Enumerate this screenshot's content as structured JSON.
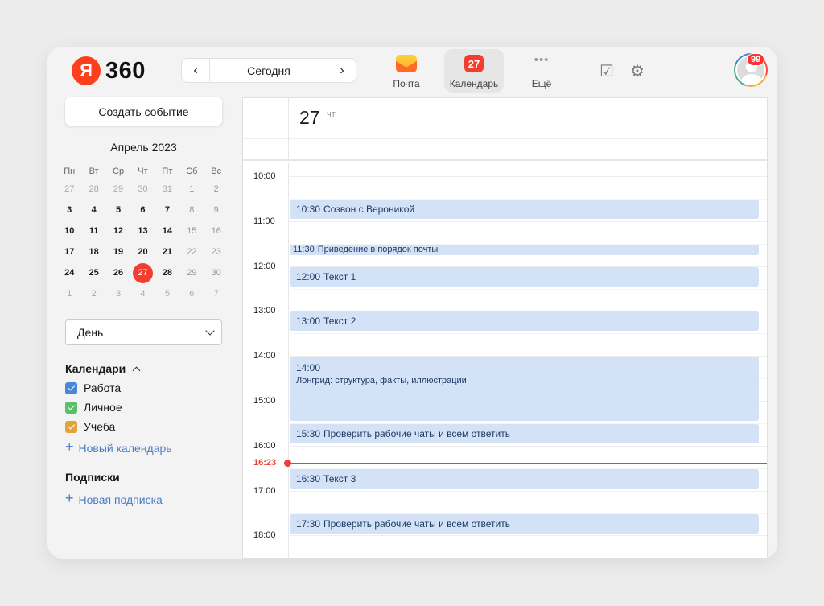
{
  "header": {
    "logo_letter": "Я",
    "logo_text": "360",
    "nav": {
      "today": "Сегодня",
      "prev": "‹",
      "next": "›"
    },
    "services": [
      {
        "label": "Почта",
        "icon": "mail-icon"
      },
      {
        "label": "Календарь",
        "icon": "calendar-icon",
        "badge": "27",
        "active": true
      },
      {
        "label": "Ещё",
        "icon": "more-icon"
      }
    ],
    "avatar_badge": "99"
  },
  "sidebar": {
    "create_label": "Создать событие",
    "month_title": "Апрель 2023",
    "weekdays": [
      "Пн",
      "Вт",
      "Ср",
      "Чт",
      "Пт",
      "Сб",
      "Вс"
    ],
    "weeks": [
      [
        "27",
        "28",
        "29",
        "30",
        "31",
        "1",
        "2"
      ],
      [
        "3",
        "4",
        "5",
        "6",
        "7",
        "8",
        "9"
      ],
      [
        "10",
        "11",
        "12",
        "13",
        "14",
        "15",
        "16"
      ],
      [
        "17",
        "18",
        "19",
        "20",
        "21",
        "22",
        "23"
      ],
      [
        "24",
        "25",
        "26",
        "27",
        "28",
        "29",
        "30"
      ],
      [
        "1",
        "2",
        "3",
        "4",
        "5",
        "6",
        "7"
      ]
    ],
    "view_select": "День",
    "calendars_title": "Календари",
    "calendars": [
      {
        "label": "Работа",
        "color": "#4a86d9"
      },
      {
        "label": "Личное",
        "color": "#5bbf6a"
      },
      {
        "label": "Учеба",
        "color": "#e2a33b"
      }
    ],
    "new_calendar": "Новый календарь",
    "subscriptions_title": "Подписки",
    "new_subscription": "Новая подписка"
  },
  "day_view": {
    "day_number": "27",
    "weekday": "чт",
    "hours": [
      "10:00",
      "11:00",
      "12:00",
      "13:00",
      "14:00",
      "15:00",
      "16:00",
      "17:00",
      "18:00"
    ],
    "now_label": "16:23",
    "events": [
      {
        "time": "10:30",
        "title": "Созвон с Вероникой"
      },
      {
        "time": "11:30",
        "title": "Приведение в порядок почты"
      },
      {
        "time": "12:00",
        "title": "Текст 1"
      },
      {
        "time": "13:00",
        "title": "Текст 2"
      },
      {
        "time": "14:00",
        "title": "Лонгрид: структура, факты, иллюстрации"
      },
      {
        "time": "15:30",
        "title": "Проверить рабочие чаты и всем ответить"
      },
      {
        "time": "16:30",
        "title": "Текст 3"
      },
      {
        "time": "17:30",
        "title": "Проверить рабочие чаты и всем ответить"
      }
    ]
  }
}
